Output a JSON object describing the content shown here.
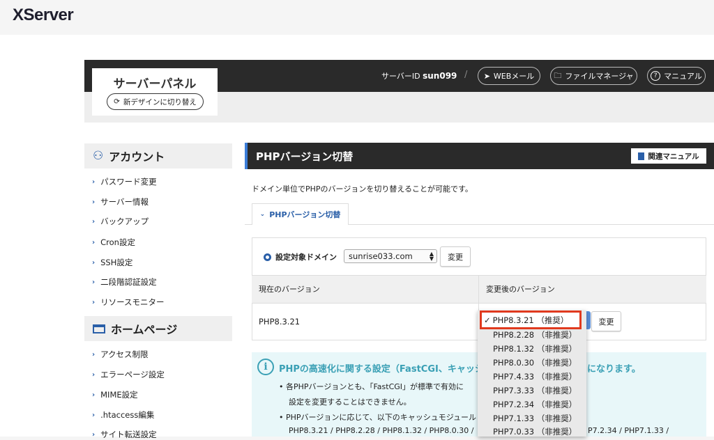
{
  "logo": "XServer",
  "header": {
    "panel_title": "サーバーパネル",
    "design_button": "新デザインに切り替え",
    "server_id_label": "サーバーID",
    "server_id_value": "sun099",
    "separator": "/",
    "webmail": "WEBメール",
    "file_manager": "ファイルマネージャ",
    "manual": "マニュアル"
  },
  "sidebar": {
    "account_title": "アカウント",
    "account_items": [
      "パスワード変更",
      "サーバー情報",
      "バックアップ",
      "Cron設定",
      "SSH設定",
      "二段階認証設定",
      "リソースモニター"
    ],
    "homepage_title": "ホームページ",
    "homepage_items": [
      "アクセス制限",
      "エラーページ設定",
      "MIME設定",
      ".htaccess編集",
      "サイト転送設定"
    ]
  },
  "main": {
    "title": "PHPバージョン切替",
    "manual_button": "関連マニュアル",
    "description": "ドメイン単位でPHPのバージョンを切り替えることが可能です。",
    "tab_label": "PHPバージョン切替",
    "domain_label": "設定対象ドメイン",
    "domain_value": "sunrise033.com",
    "change_button": "変更",
    "col_current": "現在のバージョン",
    "col_after": "変更後のバージョン",
    "current_version": "PHP8.3.21",
    "change_button2": "変更"
  },
  "dropdown": {
    "selected": "PHP8.3.21 （推奨）",
    "options": [
      "PHP8.2.28 （非推奨）",
      "PHP8.1.32 （非推奨）",
      "PHP8.0.30 （非推奨）",
      "PHP7.4.33 （非推奨）",
      "PHP7.3.33 （非推奨）",
      "PHP7.2.34 （非推奨）",
      "PHP7.1.33 （非推奨）",
      "PHP7.0.33 （非推奨）"
    ],
    "highlight_color": "#e03a1e"
  },
  "info": {
    "title_a": "PHPの高速化に関する設定（FastCGI、キャッシュ",
    "title_b": "になります。",
    "bullet1_a": "各PHPバージョンとも、「FastCGI」が標準で有効に",
    "bullet1_b": "設定を変更することはできません。",
    "bullet2_a": "PHPバージョンに応じて、以下のキャッシュモジュール",
    "versions_a": "PHP8.3.21 / PHP8.2.28 / PHP8.1.32 / PHP8.0.30 /",
    "versions_b": "P7.2.34 / PHP7.1.33 /"
  }
}
